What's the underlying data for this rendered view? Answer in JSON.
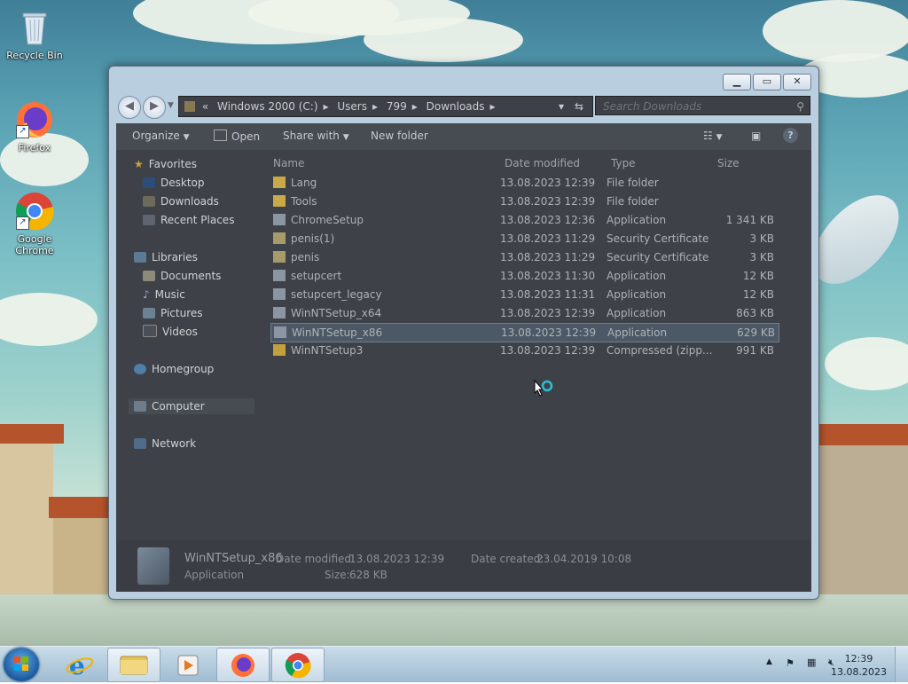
{
  "desktop": {
    "icons": [
      {
        "label": "Recycle Bin"
      },
      {
        "label": "Firefox"
      },
      {
        "label": "Google Chrome"
      }
    ]
  },
  "window": {
    "address": {
      "chevron": "«",
      "crumbs": [
        "Windows 2000 (C:)",
        "Users",
        "799",
        "Downloads"
      ]
    },
    "search_placeholder": "Search Downloads",
    "toolbar": {
      "organize": "Organize",
      "open": "Open",
      "share_with": "Share with",
      "new_folder": "New folder"
    },
    "nav": {
      "favorites": "Favorites",
      "desktop": "Desktop",
      "downloads": "Downloads",
      "recent_places": "Recent Places",
      "libraries": "Libraries",
      "documents": "Documents",
      "music": "Music",
      "pictures": "Pictures",
      "videos": "Videos",
      "homegroup": "Homegroup",
      "computer": "Computer",
      "network": "Network"
    },
    "columns": {
      "name": "Name",
      "date_modified": "Date modified",
      "type": "Type",
      "size": "Size"
    },
    "files": [
      {
        "name": "Lang",
        "date": "13.08.2023 12:39",
        "type": "File folder",
        "size": "",
        "kind": "folder"
      },
      {
        "name": "Tools",
        "date": "13.08.2023 12:39",
        "type": "File folder",
        "size": "",
        "kind": "folder"
      },
      {
        "name": "ChromeSetup",
        "date": "13.08.2023 12:36",
        "type": "Application",
        "size": "1 341 KB",
        "kind": "app"
      },
      {
        "name": "penis(1)",
        "date": "13.08.2023 11:29",
        "type": "Security Certificate",
        "size": "3 KB",
        "kind": "cert"
      },
      {
        "name": "penis",
        "date": "13.08.2023 11:29",
        "type": "Security Certificate",
        "size": "3 KB",
        "kind": "cert"
      },
      {
        "name": "setupcert",
        "date": "13.08.2023 11:30",
        "type": "Application",
        "size": "12 KB",
        "kind": "app"
      },
      {
        "name": "setupcert_legacy",
        "date": "13.08.2023 11:31",
        "type": "Application",
        "size": "12 KB",
        "kind": "app"
      },
      {
        "name": "WinNTSetup_x64",
        "date": "13.08.2023 12:39",
        "type": "Application",
        "size": "863 KB",
        "kind": "app"
      },
      {
        "name": "WinNTSetup_x86",
        "date": "13.08.2023 12:39",
        "type": "Application",
        "size": "629 KB",
        "kind": "app",
        "selected": true
      },
      {
        "name": "WinNTSetup3",
        "date": "13.08.2023 12:39",
        "type": "Compressed (zipp...",
        "size": "991 KB",
        "kind": "zip"
      }
    ],
    "details": {
      "name": "WinNTSetup_x86",
      "type": "Application",
      "date_modified_label": "Date modified:",
      "date_modified": "13.08.2023 12:39",
      "date_created_label": "Date created:",
      "date_created": "23.04.2019 10:08",
      "size_label": "Size:",
      "size": "628 KB"
    }
  },
  "taskbar": {
    "clock_time": "12:39",
    "clock_date": "13.08.2023"
  },
  "colors": {
    "window_frame": "#b9cfe0",
    "content_bg": "#3e4248",
    "taskbar": "#b8cfe0",
    "selection": "#4c5866"
  }
}
